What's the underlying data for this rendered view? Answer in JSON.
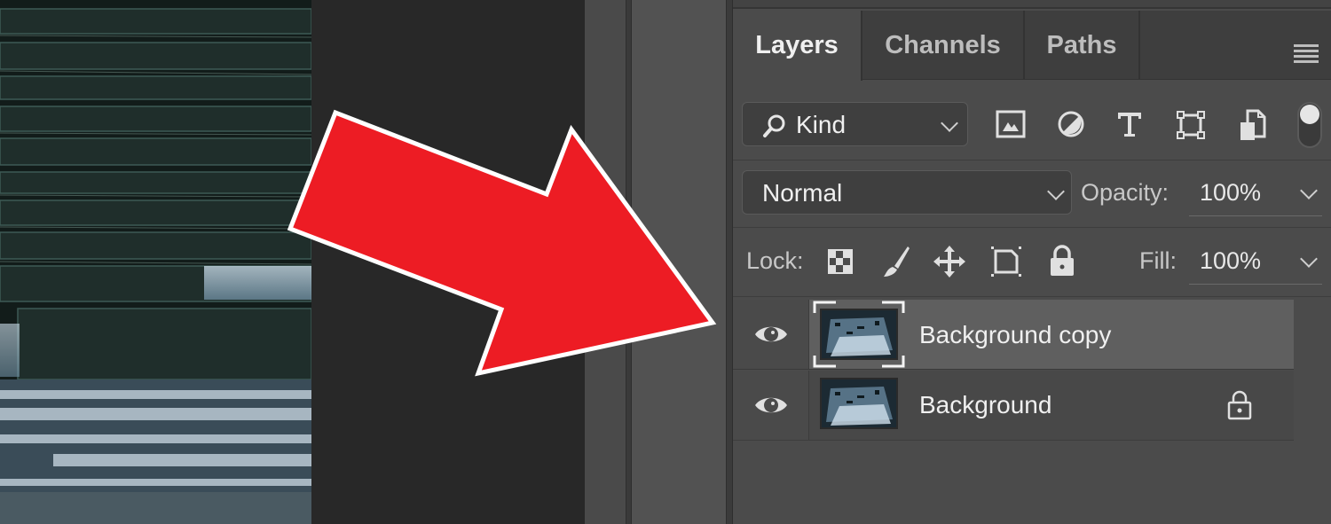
{
  "canvas": {
    "photo_subject": "cascading waterfall over rock ledges"
  },
  "annotation": {
    "arrow_color": "#ed1c24",
    "arrow_outline_color": "#ffffff",
    "arrow_direction": "pointing to Background copy layer"
  },
  "layers_panel": {
    "tabs": [
      {
        "label": "Layers",
        "active": true
      },
      {
        "label": "Channels",
        "active": false
      },
      {
        "label": "Paths",
        "active": false
      }
    ],
    "panel_menu_icon": "hamburger-menu-icon",
    "filter": {
      "kind_label": "Kind",
      "search_icon": "search-icon",
      "filter_icons": [
        "image-filter-icon",
        "adjustment-filter-icon",
        "type-filter-icon",
        "shape-filter-icon",
        "smart-object-filter-icon"
      ],
      "toggle_state": "on"
    },
    "blend_mode": "Normal",
    "opacity_label": "Opacity:",
    "opacity_value": "100%",
    "lock_label": "Lock:",
    "lock_icons": [
      "lock-transparent-pixels-icon",
      "lock-image-pixels-icon",
      "lock-position-icon",
      "lock-artboard-icon",
      "lock-all-icon"
    ],
    "fill_label": "Fill:",
    "fill_value": "100%",
    "layers": [
      {
        "name": "Background copy",
        "visible": true,
        "selected": true,
        "locked": false
      },
      {
        "name": "Background",
        "visible": true,
        "selected": false,
        "locked": true
      }
    ]
  }
}
